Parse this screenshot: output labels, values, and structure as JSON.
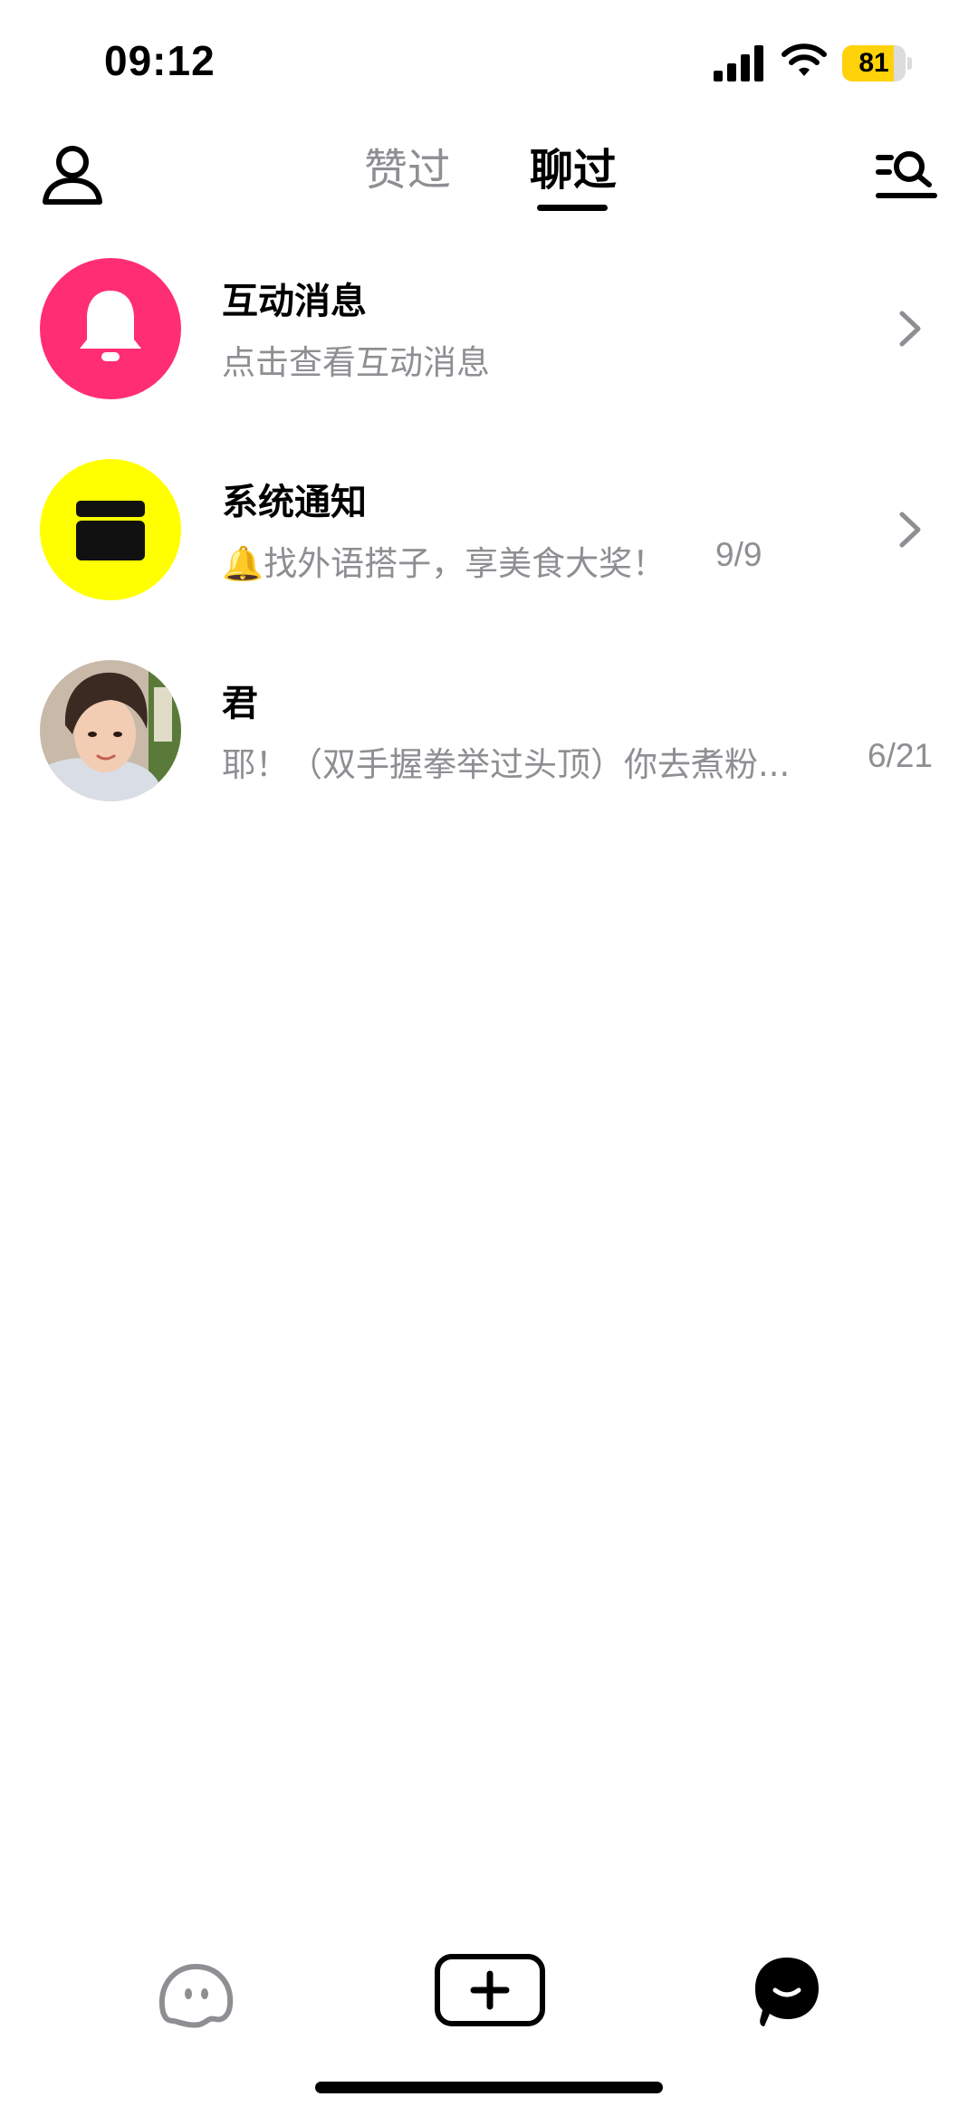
{
  "status_bar": {
    "time": "09:12",
    "battery_level": "81",
    "battery_fraction": 0.81,
    "battery_color": "#ffd20a"
  },
  "top_nav": {
    "tabs": [
      {
        "label": "赞过",
        "active": false
      },
      {
        "label": "聊过",
        "active": true
      }
    ],
    "left_icon": "person-icon",
    "right_icon": "search-list-icon"
  },
  "messages": [
    {
      "title": "互动消息",
      "preview": "点击查看互动消息",
      "date": "",
      "avatar_icon": "bell-icon",
      "avatar_color": "#ff2e74",
      "has_chevron": true
    },
    {
      "title": "系统通知",
      "preview": "🔔找外语搭子，享美食大奖！",
      "date": "9/9",
      "avatar_icon": "inbox-icon",
      "avatar_color": "#ffff00",
      "has_chevron": true
    },
    {
      "title": "君",
      "preview": "耶！（双手握拳举过头顶）你去煮粉...",
      "date": "6/21",
      "avatar_icon": "user-portrait",
      "has_chevron": false
    }
  ],
  "bottom_bar": {
    "items": [
      {
        "icon": "ghost-face-icon",
        "active": false
      },
      {
        "icon": "plus-square-icon",
        "active": false
      },
      {
        "icon": "chat-bubble-icon",
        "active": true
      }
    ]
  }
}
